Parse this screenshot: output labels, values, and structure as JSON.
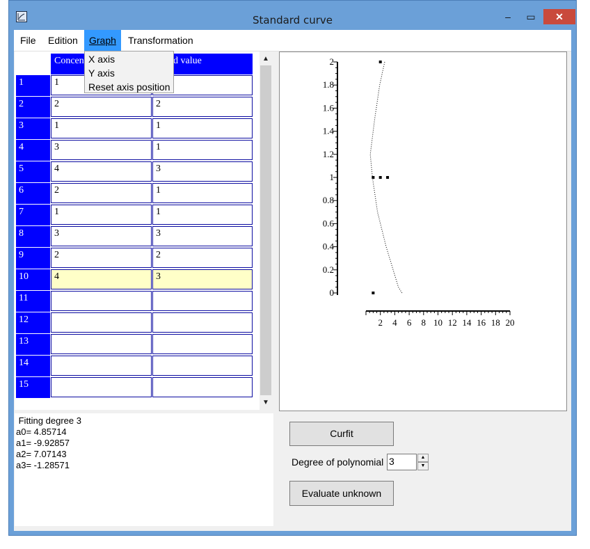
{
  "window": {
    "title": "Standard curve",
    "minimize": "–",
    "maximize": "▭",
    "close": "✕"
  },
  "menu": {
    "file": "File",
    "edition": "Edition",
    "graph": "Graph",
    "transformation": "Transformation",
    "graph_dropdown": [
      "X axis",
      "Y axis",
      "Reset axis position"
    ]
  },
  "table": {
    "columns": [
      "Concen",
      "d value"
    ],
    "rows": [
      {
        "num": "1",
        "a": "1",
        "b": ""
      },
      {
        "num": "2",
        "a": "2",
        "b": "2"
      },
      {
        "num": "3",
        "a": "1",
        "b": "1"
      },
      {
        "num": "4",
        "a": "3",
        "b": "1"
      },
      {
        "num": "5",
        "a": "4",
        "b": "3"
      },
      {
        "num": "6",
        "a": "2",
        "b": "1"
      },
      {
        "num": "7",
        "a": "1",
        "b": "1"
      },
      {
        "num": "8",
        "a": "3",
        "b": "3"
      },
      {
        "num": "9",
        "a": "2",
        "b": "2"
      },
      {
        "num": "10",
        "a": "4",
        "b": "3"
      },
      {
        "num": "11",
        "a": "",
        "b": ""
      },
      {
        "num": "12",
        "a": "",
        "b": ""
      },
      {
        "num": "13",
        "a": "",
        "b": ""
      },
      {
        "num": "14",
        "a": "",
        "b": ""
      },
      {
        "num": "15",
        "a": "",
        "b": ""
      }
    ],
    "selected_row": "10"
  },
  "results": {
    "lines": [
      " Fitting degree 3",
      "a0= 4.85714",
      "a1= -9.92857",
      "a2= 7.07143",
      "a3= -1.28571"
    ]
  },
  "controls": {
    "curfit": "Curfit",
    "degree_label": "Degree of polynomial",
    "degree_value": "3",
    "evaluate": "Evaluate unknown"
  },
  "chart_data": {
    "type": "scatter",
    "x_ticks": [
      "2",
      "4",
      "6",
      "8",
      "10",
      "12",
      "14",
      "16",
      "18",
      "20"
    ],
    "y_ticks": [
      "2",
      "1.8",
      "1.6",
      "1.4",
      "1.2",
      "1",
      "0.8",
      "0.6",
      "0.4",
      "0.2",
      "0"
    ],
    "xlim": [
      0,
      20
    ],
    "ylim": [
      0,
      2
    ],
    "points": [
      [
        1,
        0
      ],
      [
        2,
        2
      ],
      [
        1,
        1
      ],
      [
        2,
        1
      ],
      [
        3,
        1
      ]
    ],
    "curve": [
      [
        5,
        0
      ],
      [
        4.5,
        0.05
      ],
      [
        2.8,
        0.4
      ],
      [
        1.6,
        0.7
      ],
      [
        0.9,
        1.0
      ],
      [
        0.6,
        1.2
      ],
      [
        1.2,
        1.5
      ],
      [
        1.9,
        1.8
      ],
      [
        2.6,
        2.0
      ]
    ]
  }
}
